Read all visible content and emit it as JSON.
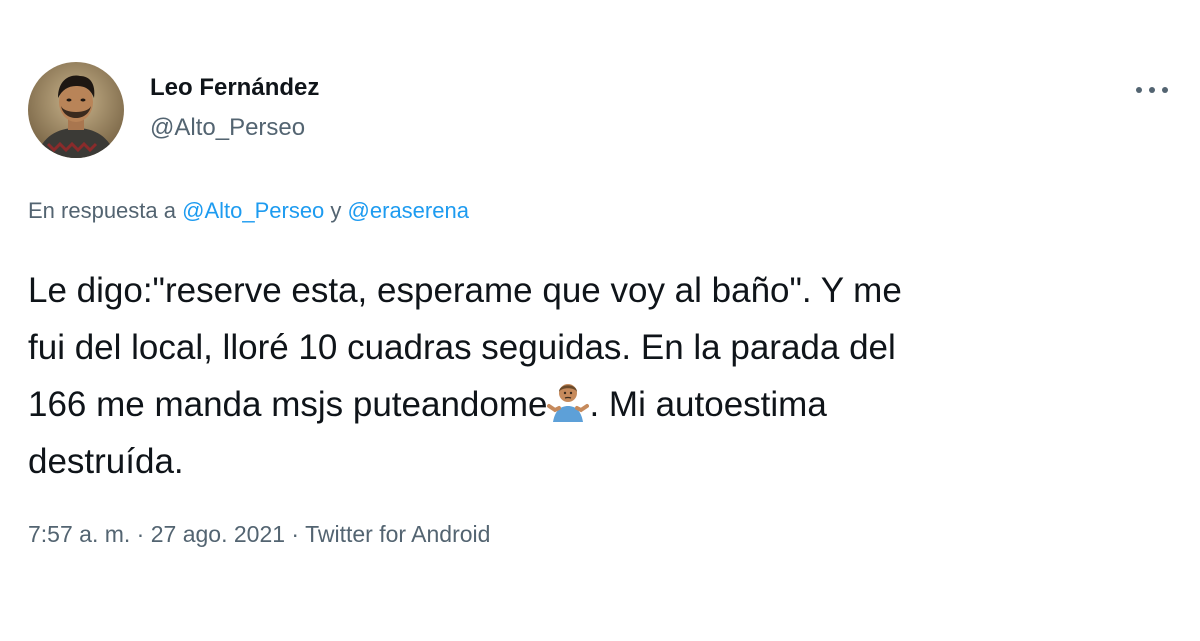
{
  "author": {
    "display_name": "Leo Fernández",
    "handle": "@Alto_Perseo"
  },
  "reply": {
    "prefix": "En respuesta a",
    "mention_1": "@Alto_Perseo",
    "conjunction": "y",
    "mention_2": "@eraserena"
  },
  "tweet": {
    "line_1": "Le digo:\"reserve esta, esperame que voy al baño\". Y me",
    "line_2": "fui del local, lloré 10 cuadras seguidas. En la parada del",
    "line_3_before": "166 me manda msjs puteandome",
    "line_3_after": ". Mi autoestima",
    "line_4": "destruída.",
    "emoji": "man-shrugging-emoji"
  },
  "meta": {
    "time": "7:57 a. m.",
    "separator": "·",
    "date": "27 ago. 2021",
    "source": "Twitter for Android"
  },
  "icons": {
    "more": "more-horizontal-icon"
  },
  "colors": {
    "text": "#0f1419",
    "secondary": "#536471",
    "link": "#1d9bf0"
  }
}
